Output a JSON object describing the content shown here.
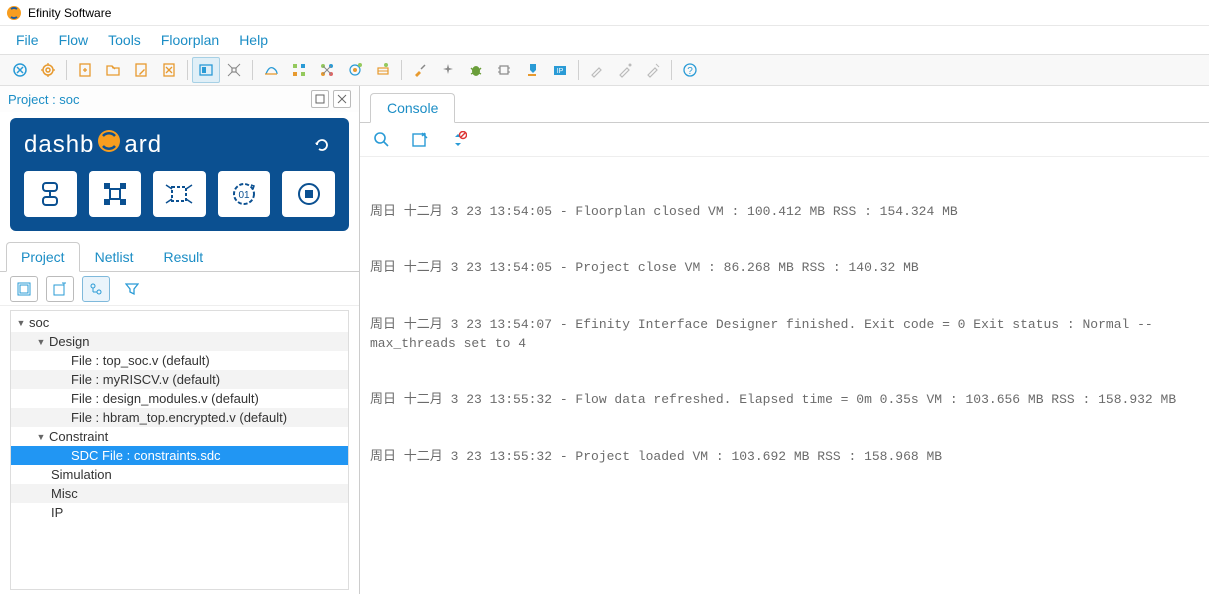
{
  "app": {
    "title": "Efinity Software"
  },
  "menubar": [
    "File",
    "Flow",
    "Tools",
    "Floorplan",
    "Help"
  ],
  "panel": {
    "title": "Project : soc"
  },
  "dashboard": {
    "text_pre": "dashb",
    "text_post": "ard"
  },
  "tabs": {
    "project": "Project",
    "netlist": "Netlist",
    "result": "Result"
  },
  "tree": {
    "root": "soc",
    "design": "Design",
    "files": [
      "File : top_soc.v (default)",
      "File : myRISCV.v (default)",
      "File : design_modules.v (default)",
      "File : hbram_top.encrypted.v (default)"
    ],
    "constraint": "Constraint",
    "sdc": "SDC File : constraints.sdc",
    "simulation": "Simulation",
    "misc": "Misc",
    "ip": "IP"
  },
  "console": {
    "tab": "Console",
    "lines": [
      "周日 十二月 3 23 13:54:05 - Floorplan closed VM : 100.412 MB RSS : 154.324 MB",
      "周日 十二月 3 23 13:54:05 - Project close VM : 86.268 MB RSS : 140.32 MB",
      "周日 十二月 3 23 13:54:07 - Efinity Interface Designer finished. Exit code = 0 Exit status : Normal --max_threads set to 4",
      "周日 十二月 3 23 13:55:32 - Flow data refreshed. Elapsed time = 0m 0.35s VM : 103.656 MB RSS : 158.932 MB",
      "周日 十二月 3 23 13:55:32 - Project loaded VM : 103.692 MB RSS : 158.968 MB"
    ]
  }
}
